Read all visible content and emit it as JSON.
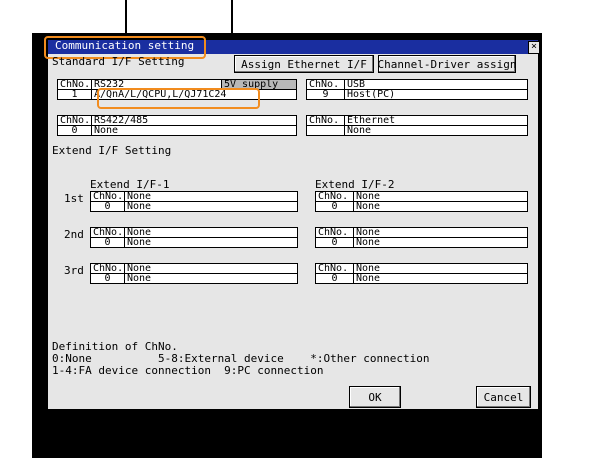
{
  "dialog": {
    "title": "Communication setting",
    "close_glyph": "×"
  },
  "standard": {
    "heading": "Standard I/F Setting",
    "assign_ethernet": "Assign Ethernet I/F",
    "channel_driver": "Channel-Driver assign",
    "rs232": {
      "chno_label": "ChNo.",
      "name": "RS232",
      "supply": "5V supply",
      "ch": "1",
      "value": "A/QnA/L/QCPU,L/QJ71C24"
    },
    "usb": {
      "chno_label": "ChNo.",
      "name": "USB",
      "ch": "9",
      "value": "Host(PC)"
    },
    "rs422": {
      "chno_label": "ChNo.",
      "name": "RS422/485",
      "ch": "0",
      "value": "None"
    },
    "ethernet": {
      "chno_label": "ChNo.",
      "name": "Ethernet",
      "ch": "",
      "value": "None"
    }
  },
  "extend": {
    "heading": "Extend I/F Setting",
    "col1": "Extend I/F-1",
    "col2": "Extend I/F-2",
    "rows": [
      {
        "label": "1st",
        "left": {
          "chno": "ChNo.",
          "name": "None",
          "ch": "0",
          "value": "None"
        },
        "right": {
          "chno": "ChNo.",
          "name": "None",
          "ch": "0",
          "value": "None"
        }
      },
      {
        "label": "2nd",
        "left": {
          "chno": "ChNo.",
          "name": "None",
          "ch": "0",
          "value": "None"
        },
        "right": {
          "chno": "ChNo.",
          "name": "None",
          "ch": "0",
          "value": "None"
        }
      },
      {
        "label": "3rd",
        "left": {
          "chno": "ChNo.",
          "name": "None",
          "ch": "0",
          "value": "None"
        },
        "right": {
          "chno": "ChNo.",
          "name": "None",
          "ch": "0",
          "value": "None"
        }
      }
    ]
  },
  "definition": {
    "heading": "Definition of ChNo.",
    "line1": "0:None          5-8:External device    *:Other connection",
    "line2": "1-4:FA device connection  9:PC connection"
  },
  "buttons": {
    "ok": "OK",
    "cancel": "Cancel"
  },
  "colors": {
    "highlight": "#f28c1e",
    "titlebar": "#1a2ea0",
    "panel": "#e6e6e6"
  }
}
